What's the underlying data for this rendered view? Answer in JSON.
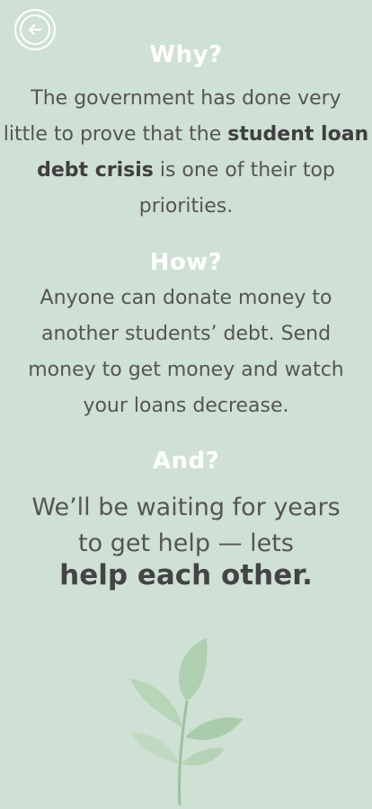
{
  "header": {
    "back_icon": "arrow-left-circle-icon"
  },
  "why": {
    "heading": "Why?",
    "line1": "The government has done very",
    "line2_pre": "little to prove that the ",
    "line2_bold": "student loan",
    "line3_bold": "debt crisis",
    "line3_post": " is one of their top",
    "line4": "priorities."
  },
  "how": {
    "heading": "How?",
    "line1": "Anyone can donate money to",
    "line2": "another students’ debt. Send",
    "line3": "money to get money and watch",
    "line4": "your loans decrease."
  },
  "and": {
    "heading": "And?",
    "line1": "We’ll be waiting for years",
    "line2": "to get help — lets",
    "line3": "help each other."
  },
  "decor": {
    "plant_icon": "leaf-plant-icon",
    "colors": {
      "background": "#cfe0d5",
      "heading": "#ffffff",
      "body": "#555555",
      "leaf": "#9cc2a0"
    }
  }
}
